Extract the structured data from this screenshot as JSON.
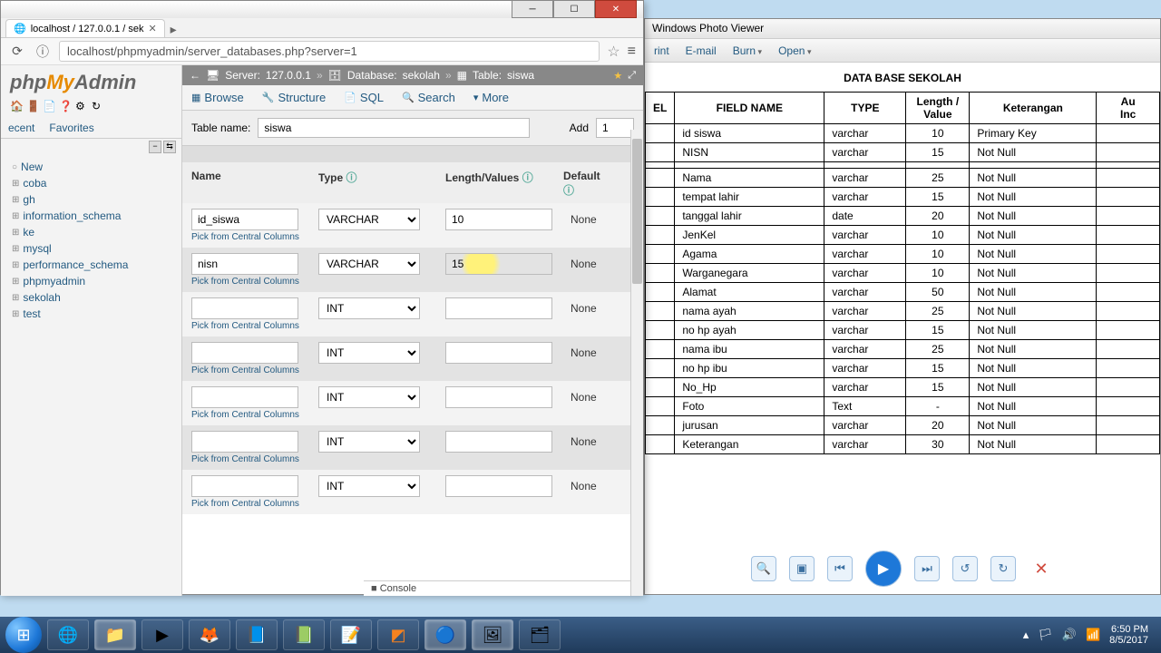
{
  "browser": {
    "tab_title": "localhost / 127.0.0.1 / sek",
    "url": "localhost/phpmyadmin/server_databases.php?server=1"
  },
  "pma": {
    "logo": {
      "php": "php",
      "my": "My",
      "admin": "Admin"
    },
    "side_tabs": {
      "recent": "ecent",
      "favorites": "Favorites"
    },
    "tree": [
      "New",
      "coba",
      "gh",
      "information_schema",
      "ke",
      "mysql",
      "performance_schema",
      "phpmyadmin",
      "sekolah",
      "test"
    ],
    "breadcrumb": {
      "server_lbl": "Server:",
      "server": "127.0.0.1",
      "db_lbl": "Database:",
      "db": "sekolah",
      "tbl_lbl": "Table:",
      "tbl": "siswa"
    },
    "tabs": {
      "browse": "Browse",
      "structure": "Structure",
      "sql": "SQL",
      "search": "Search",
      "more": "More"
    },
    "table_name_lbl": "Table name:",
    "table_name": "siswa",
    "add_lbl": "Add",
    "add_n": "1",
    "hdr": {
      "name": "Name",
      "type": "Type",
      "len": "Length/Values",
      "def": "Default"
    },
    "pick": "Pick from Central Columns",
    "rows": [
      {
        "name": "id_siswa",
        "type": "VARCHAR",
        "len": "10",
        "def": "None"
      },
      {
        "name": "nisn",
        "type": "VARCHAR",
        "len": "15",
        "def": "None",
        "focus": true
      },
      {
        "name": "",
        "type": "INT",
        "len": "",
        "def": "None"
      },
      {
        "name": "",
        "type": "INT",
        "len": "",
        "def": "None"
      },
      {
        "name": "",
        "type": "INT",
        "len": "",
        "def": "None"
      },
      {
        "name": "",
        "type": "INT",
        "len": "",
        "def": "None"
      },
      {
        "name": "",
        "type": "INT",
        "len": "",
        "def": "None"
      }
    ],
    "console": "Console"
  },
  "photo": {
    "title": "Windows Photo Viewer",
    "menu": {
      "print": "rint",
      "email": "E-mail",
      "burn": "Burn",
      "open": "Open"
    },
    "doc_title": "DATA BASE SEKOLAH",
    "hdr": {
      "el": "EL",
      "field": "FIELD NAME",
      "type": "TYPE",
      "lv": "Length / Value",
      "ket": "Keterangan",
      "au": "Au"
    },
    "rows": [
      {
        "f": "id siswa",
        "t": "varchar",
        "l": "10",
        "k": "Primary Key"
      },
      {
        "f": "NISN",
        "t": "varchar",
        "l": "15",
        "k": "Not Null"
      },
      {
        "f": "Nama",
        "t": "varchar",
        "l": "25",
        "k": "Not Null",
        "gap": true
      },
      {
        "f": "tempat lahir",
        "t": "varchar",
        "l": "15",
        "k": "Not Null"
      },
      {
        "f": "tanggal lahir",
        "t": "date",
        "l": "20",
        "k": "Not Null"
      },
      {
        "f": "JenKel",
        "t": "varchar",
        "l": "10",
        "k": "Not Null"
      },
      {
        "f": "Agama",
        "t": "varchar",
        "l": "10",
        "k": "Not Null"
      },
      {
        "f": "Warganegara",
        "t": "varchar",
        "l": "10",
        "k": "Not Null"
      },
      {
        "f": "Alamat",
        "t": "varchar",
        "l": "50",
        "k": "Not Null"
      },
      {
        "f": "nama ayah",
        "t": "varchar",
        "l": "25",
        "k": "Not Null"
      },
      {
        "f": "no hp ayah",
        "t": "varchar",
        "l": "15",
        "k": "Not Null"
      },
      {
        "f": "nama ibu",
        "t": "varchar",
        "l": "25",
        "k": "Not Null"
      },
      {
        "f": "no hp ibu",
        "t": "varchar",
        "l": "15",
        "k": "Not Null"
      },
      {
        "f": "No_Hp",
        "t": "varchar",
        "l": "15",
        "k": "Not Null"
      },
      {
        "f": "Foto",
        "t": "Text",
        "l": "-",
        "k": "Not Null"
      },
      {
        "f": "jurusan",
        "t": "varchar",
        "l": "20",
        "k": "Not Null"
      },
      {
        "f": "Keterangan",
        "t": "varchar",
        "l": "30",
        "k": "Not Null"
      }
    ]
  },
  "tray": {
    "time": "6:50 PM",
    "date": "8/5/2017"
  }
}
